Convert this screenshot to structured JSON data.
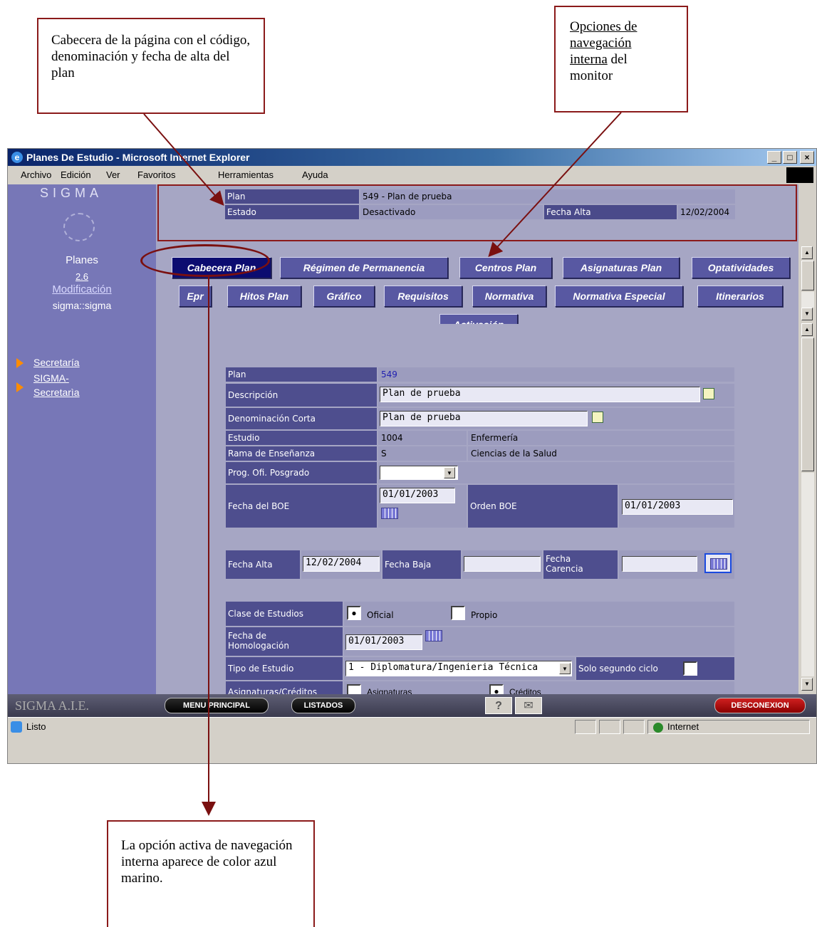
{
  "callouts": {
    "header": "Cabecera de la página con el código, denominación y fecha de alta del plan",
    "nav_underlined_1": "Opciones de",
    "nav_underlined_2": "navegación",
    "nav_underlined_3": "interna",
    "nav_rest_1": " del",
    "nav_rest_2": "monitor",
    "active": "La opción activa de navegación interna aparece de color azul marino."
  },
  "window": {
    "title": "Planes De Estudio - Microsoft Internet Explorer",
    "controls": [
      "_",
      "□",
      "×"
    ]
  },
  "menu": [
    "Archivo",
    "Edición",
    "Ver",
    "Favoritos",
    "Herramientas",
    "Ayuda"
  ],
  "sidebar": {
    "logo_text": "SIGMA",
    "module": "Planes",
    "version": "2.6",
    "mode": "Modificación",
    "user": "sigma::sigma",
    "links": [
      "Secretaría",
      "SIGMA-",
      "Secretarìa"
    ]
  },
  "header": {
    "plan_label": "Plan",
    "plan_value": "549 - Plan de prueba",
    "estado_label": "Estado",
    "estado_value": "Desactivado",
    "fecha_alta_label": "Fecha Alta",
    "fecha_alta_value": "12/02/2004"
  },
  "tabs": {
    "row1": [
      "Cabecera Plan",
      "Régimen de Permanencia",
      "Centros Plan",
      "Asignaturas Plan",
      "Optatividades"
    ],
    "row2": [
      "Epr",
      "Hitos Plan",
      "Gráfico",
      "Requisitos",
      "Normativa",
      "Normativa Especial",
      "Itinerarios"
    ],
    "row3": [
      "Activación"
    ]
  },
  "form": {
    "plan_label": "Plan",
    "plan_value": "549",
    "descripcion_label": "Descripción",
    "descripcion_value": "Plan de prueba",
    "denominacion_label": "Denominación Corta",
    "denominacion_value": "Plan de prueba",
    "estudio_label": "Estudio",
    "estudio_code": "1004",
    "estudio_name": "Enfermería",
    "rama_label": "Rama de Enseñanza",
    "rama_code": "S",
    "rama_name": "Ciencias de la Salud",
    "posgrado_label": "Prog. Ofi. Posgrado",
    "posgrado_value": "",
    "fecha_boe_label": "Fecha del BOE",
    "fecha_boe_value": "01/01/2003",
    "orden_boe_label": "Orden BOE",
    "orden_boe_value": "01/01/2003",
    "fecha_alta_label": "Fecha Alta",
    "fecha_alta_value": "12/02/2004",
    "fecha_baja_label": "Fecha Baja",
    "fecha_baja_value": "",
    "fecha_carencia_label_1": "Fecha",
    "fecha_carencia_label_2": "Carencia",
    "fecha_carencia_value": "",
    "clase_label": "Clase de Estudios",
    "clase_oficial": "Oficial",
    "clase_propio": "Propio",
    "homologacion_label_1": "Fecha de",
    "homologacion_label_2": "Homologación",
    "homologacion_value": "01/01/2003",
    "tipo_label": "Tipo de Estudio",
    "tipo_value": "1 - Diplomatura/Ingenieria Técnica",
    "segundo_ciclo_label": "Solo segundo ciclo",
    "asig_label": "Asignaturas/Créditos",
    "asig_opt1": "Asignaturas",
    "asig_opt2": "Créditos"
  },
  "bottombar": {
    "brand": "SIGMA A.I.E.",
    "menu_principal": "MENU PRINCIPAL",
    "listados": "LISTADOS",
    "help": "?",
    "desconexion": "DESCONEXION"
  },
  "status": {
    "left": "Listo",
    "zone": "Internet"
  }
}
